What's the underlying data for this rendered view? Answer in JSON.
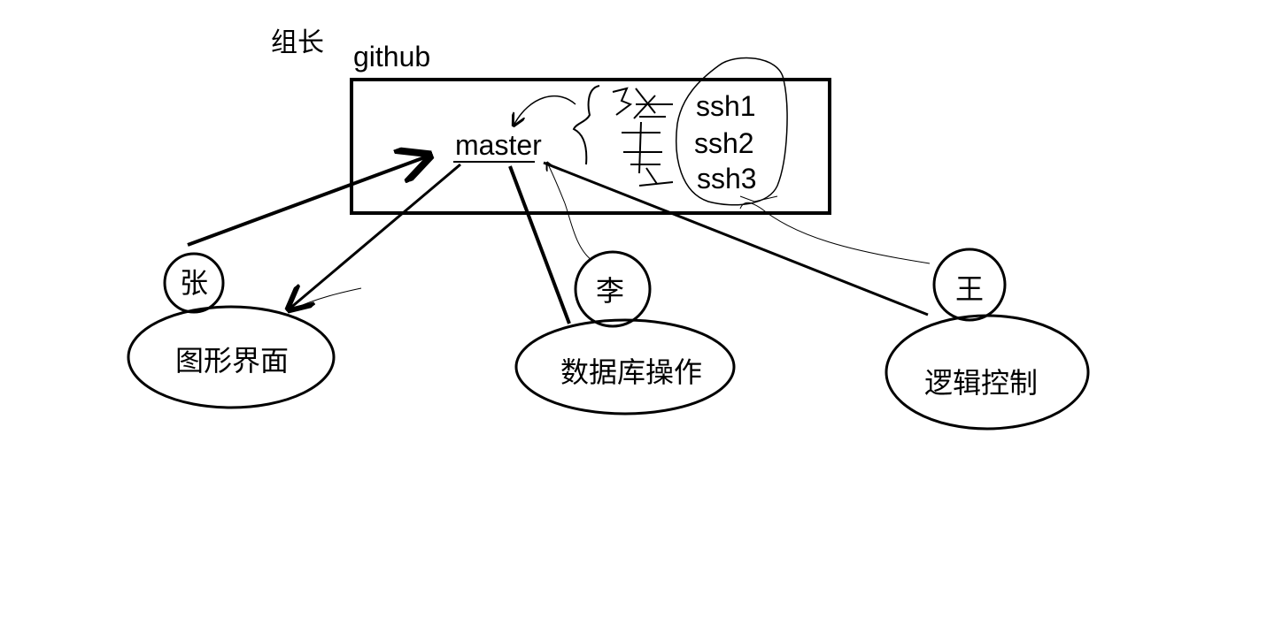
{
  "leader_label": "组长",
  "repo": {
    "host_label": "github",
    "branch_label": "master",
    "ssh_keys": [
      "ssh1",
      "ssh2",
      "ssh3"
    ],
    "scribble_mark": "3个公钥"
  },
  "members": [
    {
      "name": "张",
      "task": "图形界面"
    },
    {
      "name": "李",
      "task": "数据库操作"
    },
    {
      "name": "王",
      "task": "逻辑控制"
    }
  ]
}
